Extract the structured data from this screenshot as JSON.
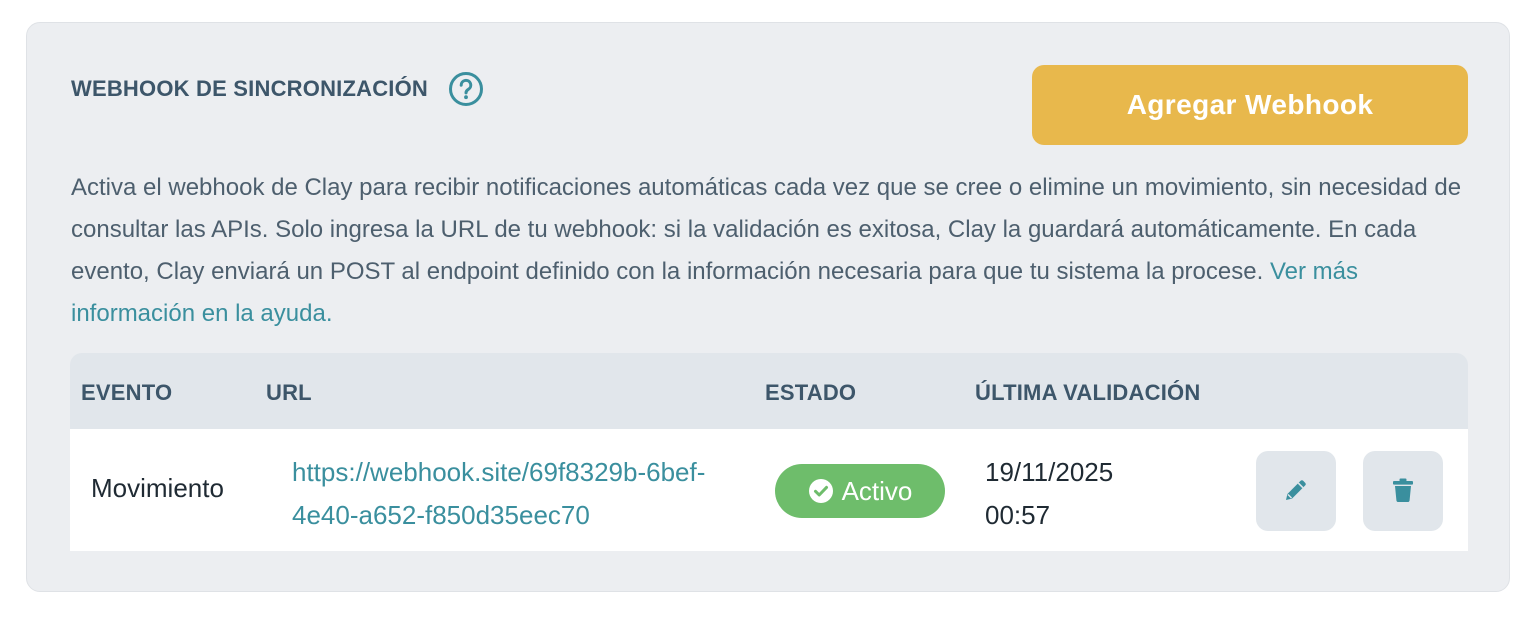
{
  "header": {
    "title": "WEBHOOK DE SINCRONIZACIÓN",
    "help_icon": "question-circle-icon",
    "add_button_label": "Agregar Webhook"
  },
  "description": {
    "text": "Activa el webhook de Clay para recibir notificaciones automáticas cada vez que se cree o elimine un movimiento, sin necesidad de consultar las APIs. Solo ingresa la URL de tu webhook: si la validación es exitosa, Clay la guardará automáticamente. En cada evento, Clay enviará un POST al endpoint definido con la información necesaria para que tu sistema la procese.",
    "link_text": "Ver más información en la ayuda."
  },
  "table": {
    "headers": {
      "evento": "EVENTO",
      "url": "URL",
      "estado": "ESTADO",
      "ultima_validacion": "ÚLTIMA VALIDACIÓN"
    },
    "rows": [
      {
        "evento": "Movimiento",
        "url": "https://webhook.site/69f8329b-6bef-4e40-a652-f850d35eec70",
        "estado": "Activo",
        "fecha": "19/11/2025",
        "hora": "00:57",
        "edit_icon": "pencil-icon",
        "delete_icon": "trash-icon"
      }
    ]
  },
  "colors": {
    "accent_button": "#e8b84c",
    "link": "#3a8f9e",
    "status_active": "#6ebd6b",
    "heading": "#3d566a"
  }
}
